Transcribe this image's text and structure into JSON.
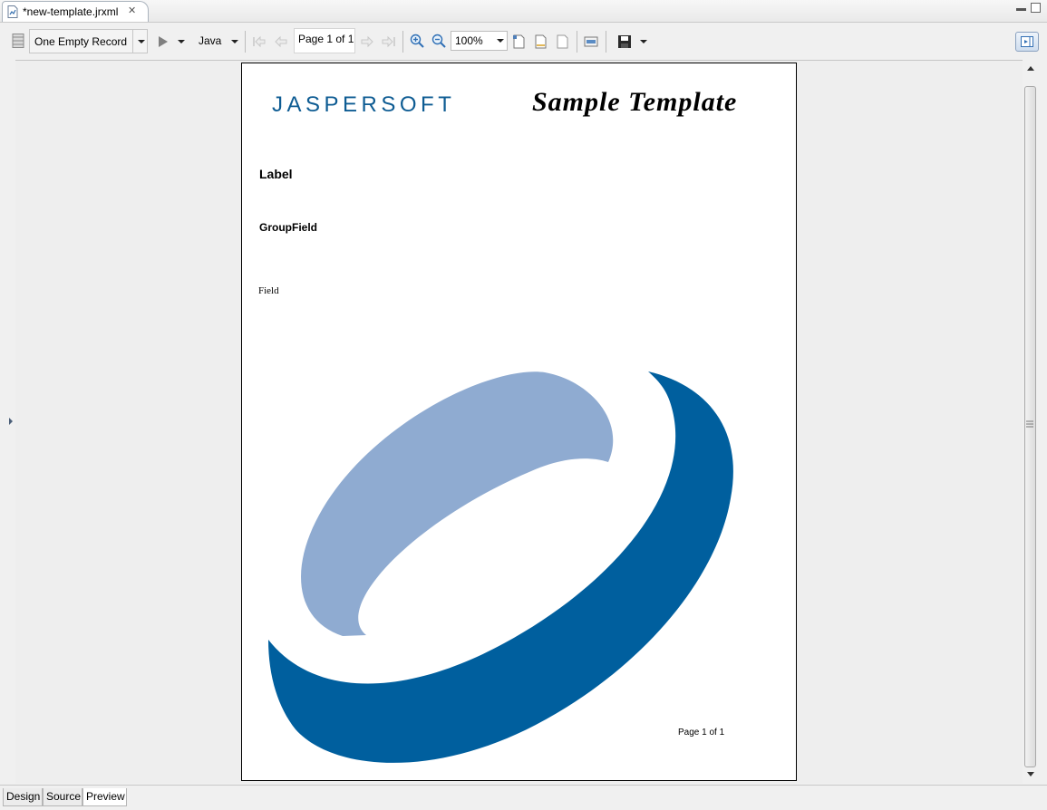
{
  "editor": {
    "tab_title": "*new-template.jrxml",
    "tab_icon": "report-file-icon",
    "close_icon": "close-icon"
  },
  "toolbar": {
    "data_adapter": "One Empty Record",
    "language": "Java",
    "page_indicator": "Page 1 of 1",
    "zoom": "100%"
  },
  "report": {
    "logo_text": "JASPERSOFT",
    "title": "Sample Template",
    "label": "Label",
    "group_field": "GroupField",
    "field": "Field",
    "page_footer": "Page 1 of 1",
    "colors": {
      "brand_dark": "#0e5c93",
      "brand_light": "#8fabd1"
    }
  },
  "bottom_tabs": [
    {
      "label": "Design"
    },
    {
      "label": "Source"
    },
    {
      "label": "Preview",
      "active": true
    }
  ]
}
